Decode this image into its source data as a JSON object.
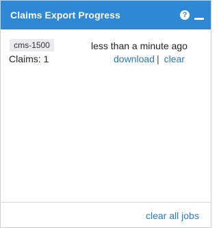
{
  "panel": {
    "title": "Claims Export Progress",
    "help_icon": "question-circle-icon",
    "minimize_icon": "minimize-icon",
    "help_glyph": "?"
  },
  "jobs": [
    {
      "name": "cms-1500",
      "time": "less than a minute ago",
      "claims": "Claims: 1",
      "download_label": "download",
      "separator": "|",
      "clear_label": "clear"
    }
  ],
  "footer": {
    "clear_all_label": "clear all jobs"
  },
  "colors": {
    "header": "#2f88d6",
    "link": "#2a78c5"
  }
}
